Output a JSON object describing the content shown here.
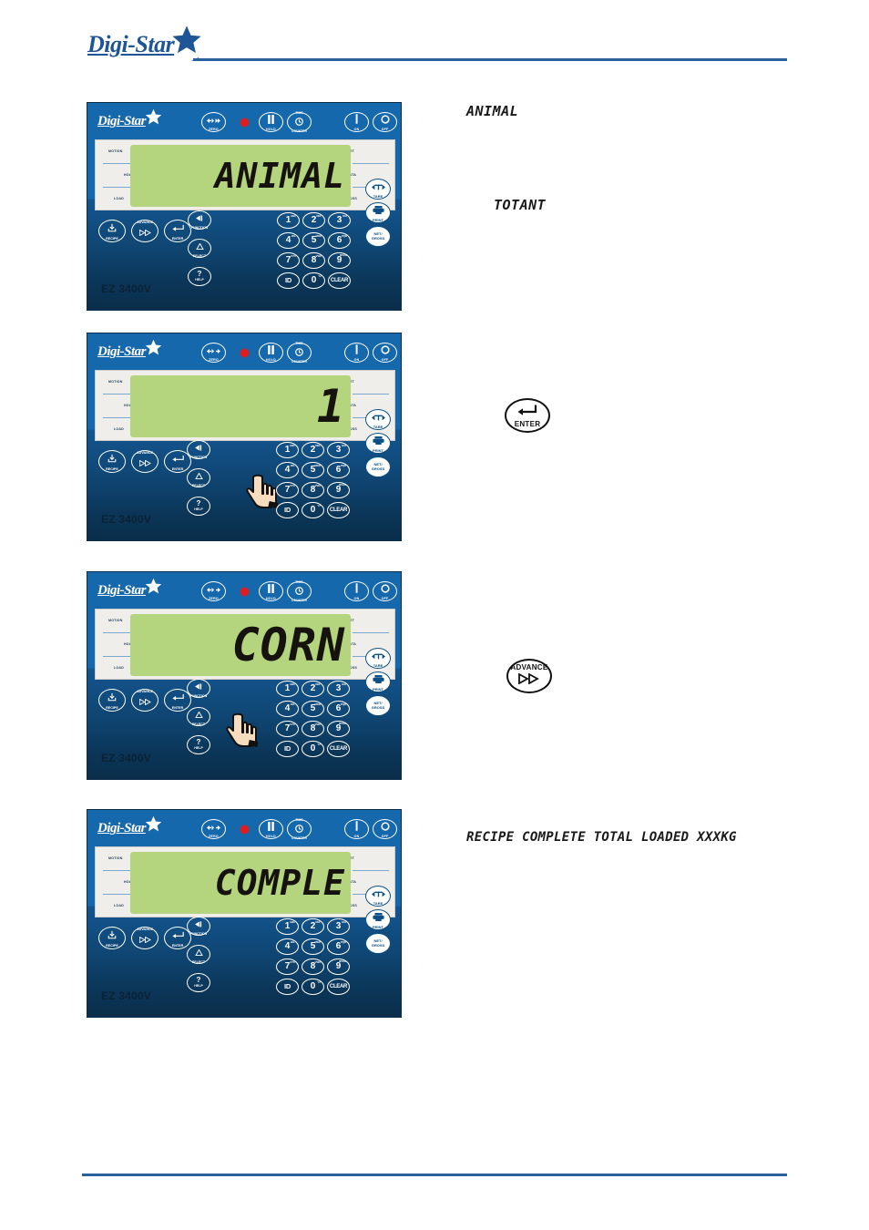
{
  "header": {
    "brand": "Digi-Star",
    "logo_icon": "star-icon"
  },
  "panels": [
    {
      "id": "panel-animal",
      "model": "EZ 3400V",
      "brand": "Digi-Star",
      "lcd_value": "ANIMAL",
      "lcd_color": "#b5d47e",
      "led_color": "#e01c1c",
      "annunciators_left": [
        "MOTION",
        "HOLD",
        "LOAD"
      ],
      "annunciators_right": [
        "NET",
        "DATA",
        "GROSS"
      ],
      "pressed_key": ""
    },
    {
      "id": "panel-one",
      "model": "EZ 3400V",
      "brand": "Digi-Star",
      "lcd_value": "1",
      "lcd_color": "#b5d47e",
      "led_color": "#e01c1c",
      "annunciators_left": [
        "MOTION",
        "HOLD",
        "LOAD"
      ],
      "annunciators_right": [
        "NET",
        "DATA",
        "GROSS"
      ],
      "pressed_key": "ENTER"
    },
    {
      "id": "panel-corn",
      "model": "EZ 3400V",
      "brand": "Digi-Star",
      "lcd_value": "CORN",
      "lcd_color": "#b5d47e",
      "led_color": "#e01c1c",
      "annunciators_left": [
        "MOTION",
        "HOLD",
        "LOAD"
      ],
      "annunciators_right": [
        "NET",
        "DATA",
        "GROSS"
      ],
      "pressed_key": "ADVANCE"
    },
    {
      "id": "panel-comple",
      "model": "EZ 3400V",
      "brand": "Digi-Star",
      "lcd_value": "COMPLE",
      "lcd_color": "#b5d47e",
      "led_color": "#e01c1c",
      "annunciators_left": [
        "MOTION",
        "HOLD",
        "LOAD"
      ],
      "annunciators_right": [
        "NET",
        "DATA",
        "GROSS"
      ],
      "pressed_key": ""
    }
  ],
  "top_buttons": [
    {
      "label": "ZERO",
      "icon": "zero-arrows-icon"
    },
    {
      "label": "HOLD",
      "icon": "pause-icon"
    },
    {
      "label": "COUNTER",
      "label2": "TIME",
      "icon": "timer-counter-icon"
    },
    {
      "label": "ON",
      "icon": "power-on-icon"
    },
    {
      "label": "OFF",
      "icon": "power-off-icon"
    }
  ],
  "side_buttons": [
    {
      "label": "TARE",
      "icon": "tare-icon"
    },
    {
      "label": "PRINT",
      "icon": "printer-icon"
    },
    {
      "label": "NET/",
      "label2": "GROSS",
      "icon": "net-gross-icon"
    }
  ],
  "function_buttons": [
    {
      "label": "RECIPE",
      "icon": "recipe-icon"
    },
    {
      "label": "ADVANCE",
      "icon": "advance-fast-forward-icon"
    },
    {
      "label": "ENTER",
      "icon": "enter-return-icon"
    }
  ],
  "keypad": [
    {
      "num": "1",
      "alpha": "ABC"
    },
    {
      "num": "2",
      "alpha": "DEF"
    },
    {
      "num": "3",
      "alpha": "GHI"
    },
    {
      "num": "4",
      "alpha": "JKL"
    },
    {
      "num": "5",
      "alpha": "MNO"
    },
    {
      "num": "6",
      "alpha": "PQR"
    },
    {
      "num": "7",
      "alpha": "STU"
    },
    {
      "num": "8",
      "alpha": "VWX"
    },
    {
      "num": "9",
      "alpha": "SPACE"
    },
    {
      "num": "ID",
      "alpha": ""
    },
    {
      "num": "0",
      "alpha": "YZ"
    },
    {
      "num": "CLEAR",
      "alpha": ""
    }
  ],
  "right_column_buttons": [
    {
      "label": "FUNCTION",
      "icon": "function-back-icon"
    },
    {
      "label": "SELECT",
      "icon": "select-up-icon"
    },
    {
      "label": "HELP",
      "icon": "question-mark-icon"
    }
  ],
  "annotations": [
    {
      "id": "note-animal",
      "text": "ANIMAL"
    },
    {
      "id": "note-totant",
      "text": "TOTANT"
    },
    {
      "id": "note-enter-icon",
      "text": "ENTER",
      "icon": "enter-return-icon"
    },
    {
      "id": "note-advance-icon",
      "text": "ADVANCE",
      "icon": "advance-fast-forward-icon"
    },
    {
      "id": "note-recipe-complete",
      "text": "RECIPE COMPLETE   TOTAL LOADED XXXKG"
    }
  ]
}
